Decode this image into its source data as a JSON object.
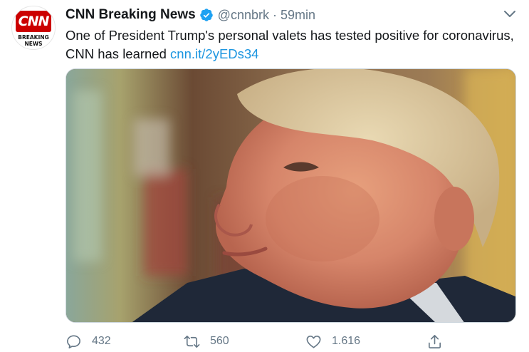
{
  "author": {
    "display_name": "CNN Breaking News",
    "handle": "@cnnbrk",
    "separator": "·",
    "time": "59min",
    "verified": true,
    "avatar": {
      "logo_text": "CNN",
      "subtitle_line1": "BREAKING",
      "subtitle_line2": "NEWS",
      "brand_color": "#cc0000"
    }
  },
  "tweet": {
    "text": "One of President Trump's personal valets has tested positive for coronavirus, CNN has learned ",
    "link": "cnn.it/2yEDs34",
    "link_color": "#1b95e0"
  },
  "media": {
    "icon": "photo-image"
  },
  "actions": {
    "reply": {
      "count": "432",
      "icon": "reply-icon"
    },
    "retweet": {
      "count": "560",
      "icon": "retweet-icon"
    },
    "like": {
      "count": "1.616",
      "icon": "heart-icon"
    },
    "share": {
      "icon": "share-icon"
    }
  },
  "colors": {
    "muted": "#657786",
    "text": "#14171a",
    "verified": "#1da1f2"
  }
}
